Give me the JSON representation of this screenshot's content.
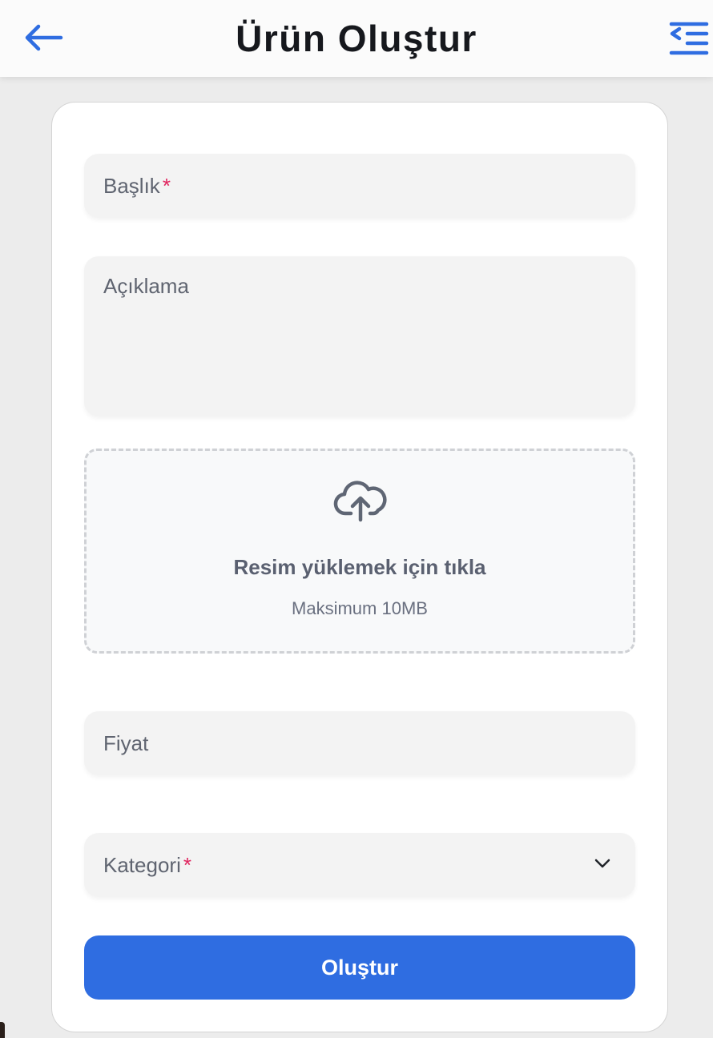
{
  "header": {
    "title": "Ürün Oluştur",
    "back_icon": "arrow-left-icon",
    "menu_icon": "indent-menu-icon",
    "accent_color": "#2f6de1"
  },
  "form": {
    "title_placeholder": "Başlık",
    "required_marker": "*",
    "description_placeholder": "Açıklama",
    "upload": {
      "icon": "cloud-upload-icon",
      "title": "Resim yüklemek için tıkla",
      "subtitle": "Maksimum 10MB"
    },
    "price_placeholder": "Fiyat",
    "category_placeholder": "Kategori",
    "category_icon": "chevron-down-icon",
    "submit_label": "Oluştur"
  }
}
